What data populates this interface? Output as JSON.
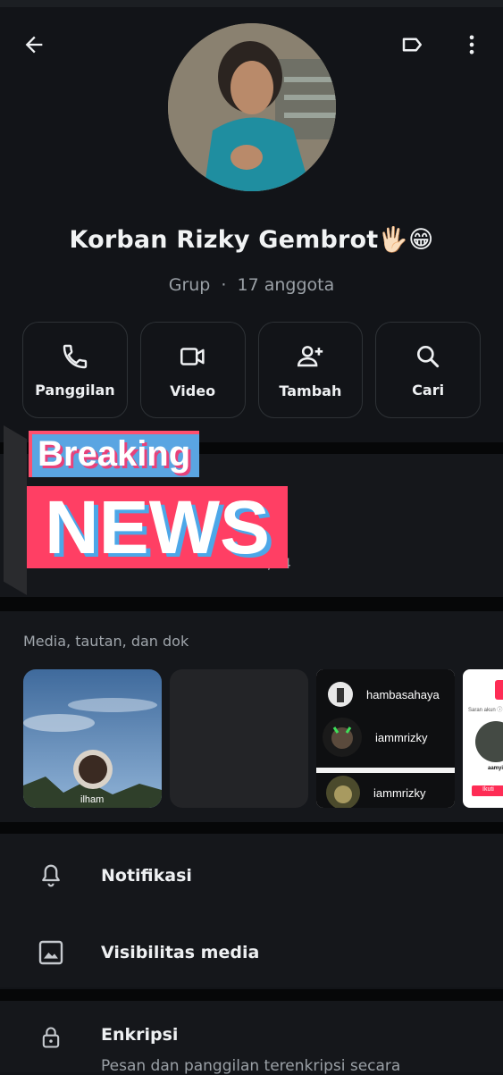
{
  "header": {
    "back_icon": "arrow-left-icon",
    "label_icon": "label-tag-icon",
    "more_icon": "more-vertical-icon"
  },
  "group": {
    "name": "Korban Rizky Gembrot🖐🏻😁",
    "type": "Grup",
    "separator": "·",
    "members": "17 anggota"
  },
  "actions": [
    {
      "label": "Panggilan",
      "icon": "phone-icon"
    },
    {
      "label": "Video",
      "icon": "video-icon"
    },
    {
      "label": "Tambah",
      "icon": "add-person-icon"
    },
    {
      "label": "Cari",
      "icon": "search-icon"
    }
  ],
  "overlay": {
    "breaking": "Breaking",
    "news": "NEWS"
  },
  "description": {
    "date": "/24"
  },
  "media": {
    "title": "Media, tautan, dan dok",
    "thumb1_caption": "ilham",
    "tiktok_rows": [
      "hambasahaya",
      "iammrizky",
      "iammrizky"
    ],
    "profile_snippet": {
      "saran": "Saran akun ⓘ",
      "username": "aamyi",
      "follow": "Ikuti"
    }
  },
  "settings": [
    {
      "label": "Notifikasi",
      "icon": "bell-icon"
    },
    {
      "label": "Visibilitas media",
      "icon": "image-icon"
    }
  ],
  "encryption": {
    "label": "Enkripsi",
    "icon": "lock-icon",
    "subtitle": "Pesan dan panggilan terenkripsi secara"
  },
  "colors": {
    "background": "#121418",
    "section": "#15171b",
    "news_red": "#ff3f64",
    "breaking_blue": "#5aa5e2"
  }
}
